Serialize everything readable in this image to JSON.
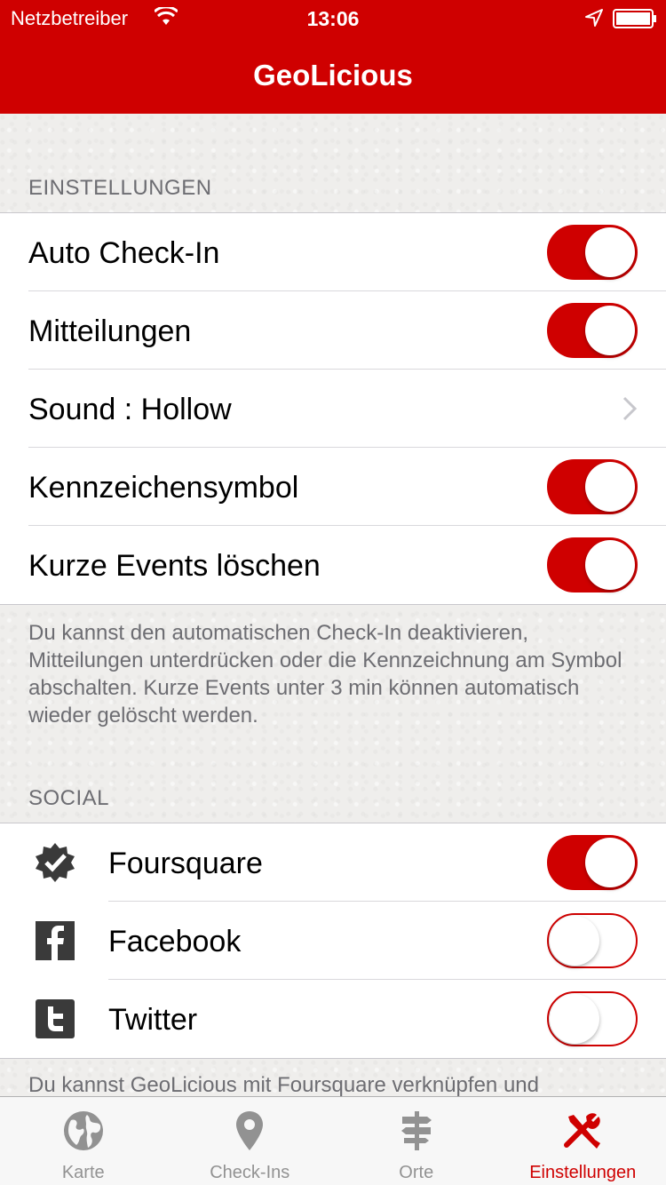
{
  "status_bar": {
    "carrier": "Netzbetreiber",
    "time": "13:06"
  },
  "nav": {
    "title": "GeoLicious"
  },
  "settings": {
    "header": "EINSTELLUNGEN",
    "rows": [
      {
        "label": "Auto Check-In",
        "control": "toggle",
        "on": true
      },
      {
        "label": "Mitteilungen",
        "control": "toggle",
        "on": true
      },
      {
        "label": "Sound : Hollow",
        "control": "disclosure"
      },
      {
        "label": "Kennzeichensymbol",
        "control": "toggle",
        "on": true
      },
      {
        "label": "Kurze Events löschen",
        "control": "toggle",
        "on": true
      }
    ],
    "footer": "Du kannst den automatischen Check-In deaktivieren, Mitteilungen unterdrücken oder die Kennzeichnung am Symbol abschalten. Kurze Events unter 3 min können automatisch wieder gelöscht werden."
  },
  "social": {
    "header": "SOCIAL",
    "rows": [
      {
        "label": "Foursquare",
        "icon": "foursquare-icon",
        "on": true
      },
      {
        "label": "Facebook",
        "icon": "facebook-icon",
        "on": false
      },
      {
        "label": "Twitter",
        "icon": "twitter-icon",
        "on": false
      }
    ],
    "footer": "Du kannst GeoLicious mit Foursquare verknüpfen und"
  },
  "tabs": [
    {
      "label": "Karte",
      "icon": "globe-icon",
      "active": false
    },
    {
      "label": "Check-Ins",
      "icon": "map-pin-icon",
      "active": false
    },
    {
      "label": "Orte",
      "icon": "signpost-icon",
      "active": false
    },
    {
      "label": "Einstellungen",
      "icon": "tools-icon",
      "active": true
    }
  ],
  "colors": {
    "accent": "#cf0000",
    "inactive": "#929292"
  }
}
